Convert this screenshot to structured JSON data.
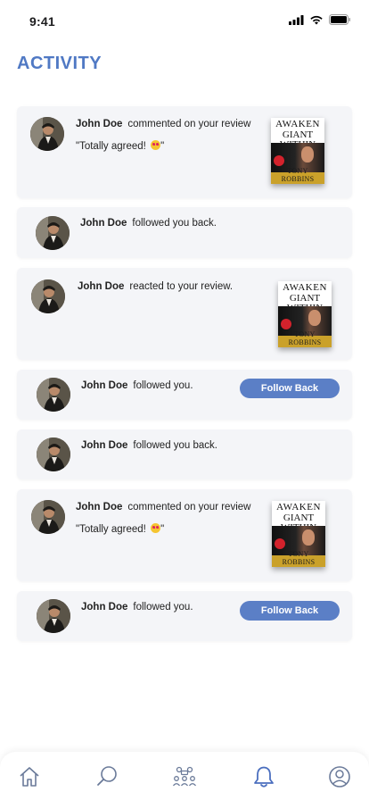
{
  "status": {
    "time": "9:41"
  },
  "page": {
    "title": "ACTIVITY"
  },
  "activities": [
    {
      "name": "John Doe",
      "action": "commented on your review",
      "quote": "\"Totally agreed! ",
      "quote_end": "\"",
      "book": {
        "t1": "AWAKEN",
        "t2": "GIANT WITHIN",
        "author": "TONY ROBBINS"
      }
    },
    {
      "name": "John Doe",
      "action": "followed you back."
    },
    {
      "name": "John Doe",
      "action": "reacted to your review.",
      "book": {
        "t1": "AWAKEN",
        "t2": "GIANT WITHIN",
        "author": "TONY ROBBINS"
      }
    },
    {
      "name": "John Doe",
      "action": "followed you.",
      "button": "Follow Back"
    },
    {
      "name": "John Doe",
      "action": "followed you back."
    },
    {
      "name": "John Doe",
      "action": "commented on your review",
      "quote": "\"Totally agreed! ",
      "quote_end": "\"",
      "book": {
        "t1": "AWAKEN",
        "t2": "GIANT WITHIN",
        "author": "TONY ROBBINS"
      }
    },
    {
      "name": "John Doe",
      "action": "followed you.",
      "button": "Follow Back"
    }
  ],
  "icons": {
    "tabs": [
      "home-icon",
      "search-icon",
      "community-icon",
      "bell-icon",
      "profile-icon"
    ],
    "active_tab": "bell-icon"
  },
  "colors": {
    "accent": "#5079c4",
    "button": "#5b7fc6",
    "card": "#f4f5f8"
  }
}
